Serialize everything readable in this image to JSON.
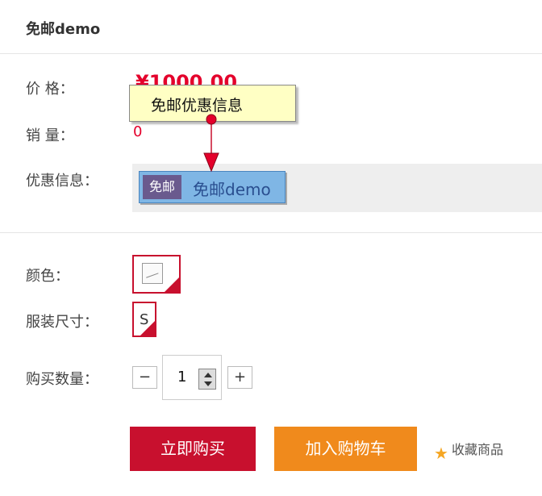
{
  "product": {
    "title": "免邮demo"
  },
  "info": {
    "price_label": "价 格：",
    "price": "¥1000.00",
    "sales_label": "销 量：",
    "sales": "0",
    "promo_label": "优惠信息：",
    "promo_badge": "免邮",
    "promo_text": "免邮demo"
  },
  "tooltip": {
    "text": "免邮优惠信息"
  },
  "options": {
    "color_label": "颜色：",
    "size_label": "服装尺寸：",
    "size_value": "S"
  },
  "quantity": {
    "label": "购买数量：",
    "minus": "−",
    "value": "1",
    "plus": "+"
  },
  "actions": {
    "buy": "立即购买",
    "cart": "加入购物车",
    "favorite": "收藏商品"
  },
  "colors": {
    "accent_red": "#c8102e",
    "price_red": "#e4002b",
    "cart_orange": "#f08a1c",
    "star_orange": "#f5a623"
  }
}
